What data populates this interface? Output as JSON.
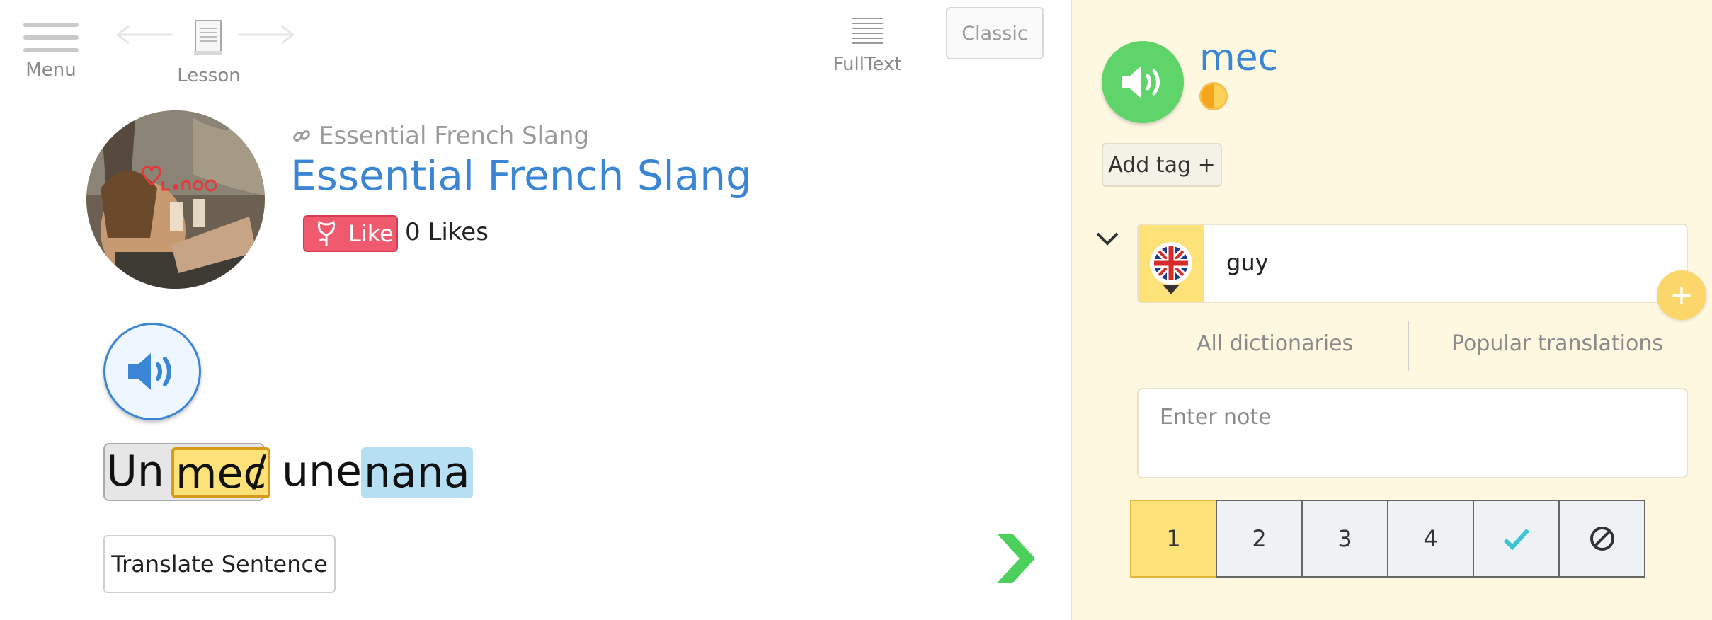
{
  "topbar": {
    "menu_label": "Menu",
    "lesson_label": "Lesson",
    "fulltext_label": "FullText",
    "classic_label": "Classic"
  },
  "lesson": {
    "course_link": "Essential French Slang",
    "title": "Essential French Slang",
    "like_label": "Like",
    "likes_count": "0 Likes"
  },
  "sentence": {
    "words": [
      "Un",
      "mec",
      "/",
      "une",
      "nana"
    ]
  },
  "translate_label": "Translate Sentence",
  "panel": {
    "term": "mec",
    "add_tag_label": "Add tag +",
    "meaning": "guy",
    "dictionaries_label": "All dictionaries",
    "popular_label": "Popular translations",
    "note_placeholder": "Enter note",
    "levels": [
      "1",
      "2",
      "3",
      "4"
    ],
    "active_level": "1"
  },
  "colors": {
    "accent_blue": "#3a86d4",
    "known_green": "#5fd46a",
    "highlight_yellow": "#fde27a",
    "lingq_blue": "#b7dff3",
    "like_red": "#f05a6e",
    "panel_bg": "#fff8e1"
  }
}
